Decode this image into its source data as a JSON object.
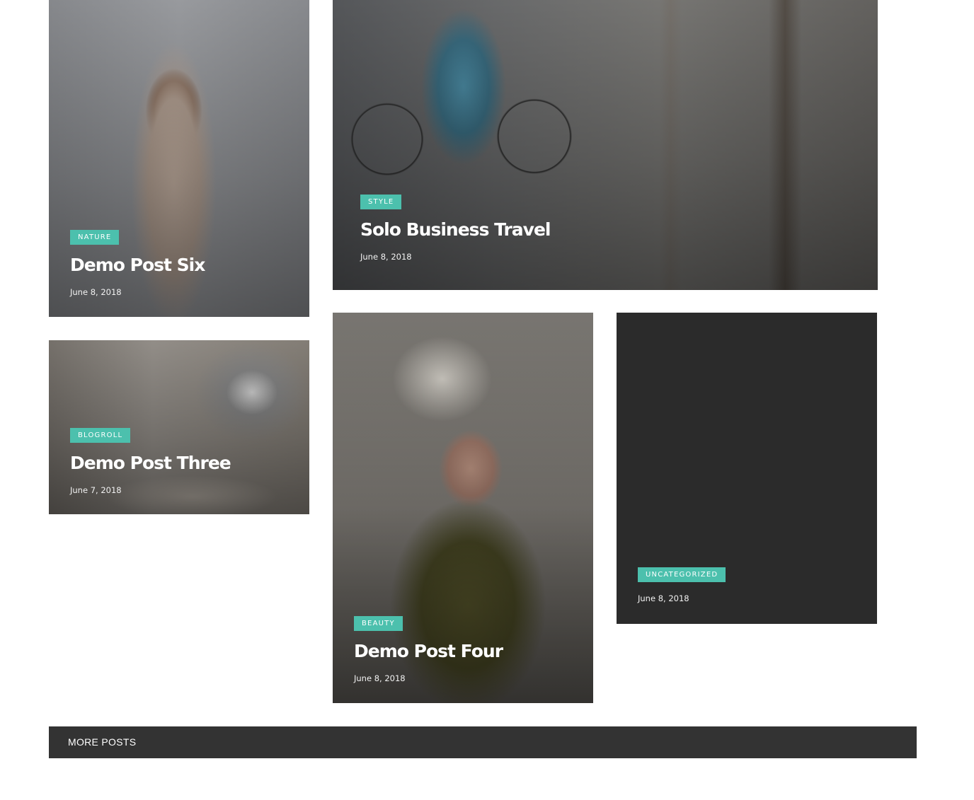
{
  "posts": [
    {
      "category": "NATURE",
      "title": "Demo Post Six",
      "date": "June 8, 2018"
    },
    {
      "category": "STYLE",
      "title": "Solo Business Travel",
      "date": "June 8, 2018"
    },
    {
      "category": "BLOGROLL",
      "title": "Demo Post Three",
      "date": "June 7, 2018"
    },
    {
      "category": "BEAUTY",
      "title": "Demo Post Four",
      "date": "June 8, 2018"
    },
    {
      "category": "UNCATEGORIZED",
      "title": "",
      "date": "June 8, 2018"
    }
  ],
  "more_posts": {
    "label": "MORE POSTS"
  },
  "colors": {
    "badge": "#4cc0ad",
    "more_posts_bar": "#333333",
    "empty_card": "#2b2b2b"
  }
}
